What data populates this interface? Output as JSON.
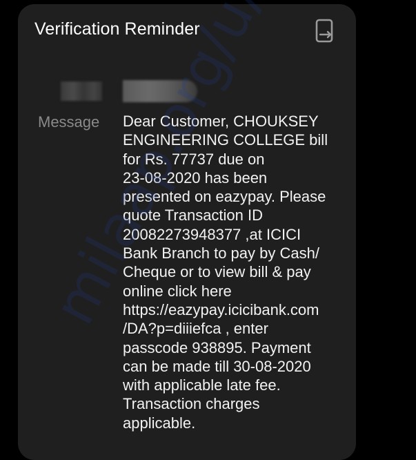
{
  "dialog": {
    "title": "Verification Reminder",
    "copy_icon": "copy-icon"
  },
  "sender": {
    "label_redacted": "",
    "value_redacted": ""
  },
  "message": {
    "label": "Message",
    "body": "Dear Customer, CHOUKSEY\nENGINEERING COLLEGE bill\nfor Rs. 77737 due on\n23-08-2020 has been\npresented on eazypay. Please\nquote Transaction ID\n20082273948377 ,at ICICI\nBank Branch to pay by Cash/\nCheque or to view bill & pay\nonline click here\nhttps://eazypay.icicibank.com\n/DA?p=diiiefca , enter\npasscode 938895. Payment\ncan be made till 30-08-2020\nwith applicable late fee.\nTransaction charges\napplicable."
  },
  "watermark": {
    "text": "milaap.org/u/7191"
  },
  "colors": {
    "background": "#000000",
    "card": "#1f1f1f",
    "title_text": "#ffffff",
    "label_text": "#8a8a8a",
    "body_text": "#f2f2f2",
    "icon": "#9a9a9a",
    "watermark": "#1f3d8a"
  }
}
